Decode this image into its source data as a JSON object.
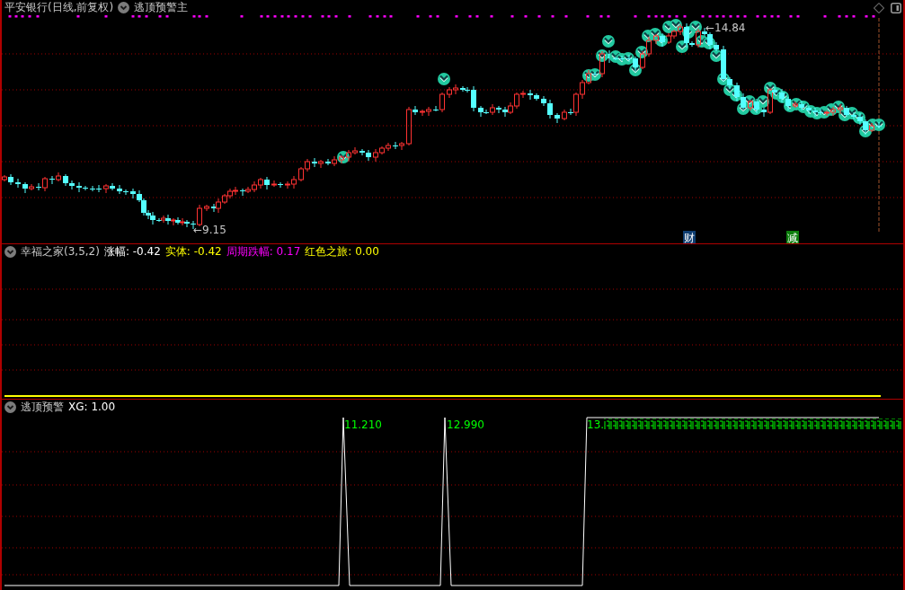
{
  "chart_header": {
    "title": "平安银行(日线,前复权)",
    "indicator": "逃顶预警主"
  },
  "main_chart": {
    "high_label": "←14.84",
    "low_label": "←9.15",
    "markers": [
      {
        "text": "财",
        "color": "#0e3d70"
      },
      {
        "text": "减",
        "color": "#0b7d0b"
      }
    ]
  },
  "indicator_panel": {
    "title": "幸福之家(3,5,2)",
    "readings": [
      {
        "label": "涨幅: -0.42",
        "color": "#ffffff"
      },
      {
        "label": "实体: -0.42",
        "color": "#ffff00"
      },
      {
        "label": "周期跌幅: 0.17",
        "color": "#ff00ff"
      },
      {
        "label": "红色之旅: 0.00",
        "color": "#ffff00"
      }
    ]
  },
  "signal_panel": {
    "title": "逃顶预警",
    "reading": "XG: 1.00",
    "value_labels": [
      "11.210",
      "12.990",
      "13."
    ]
  }
}
